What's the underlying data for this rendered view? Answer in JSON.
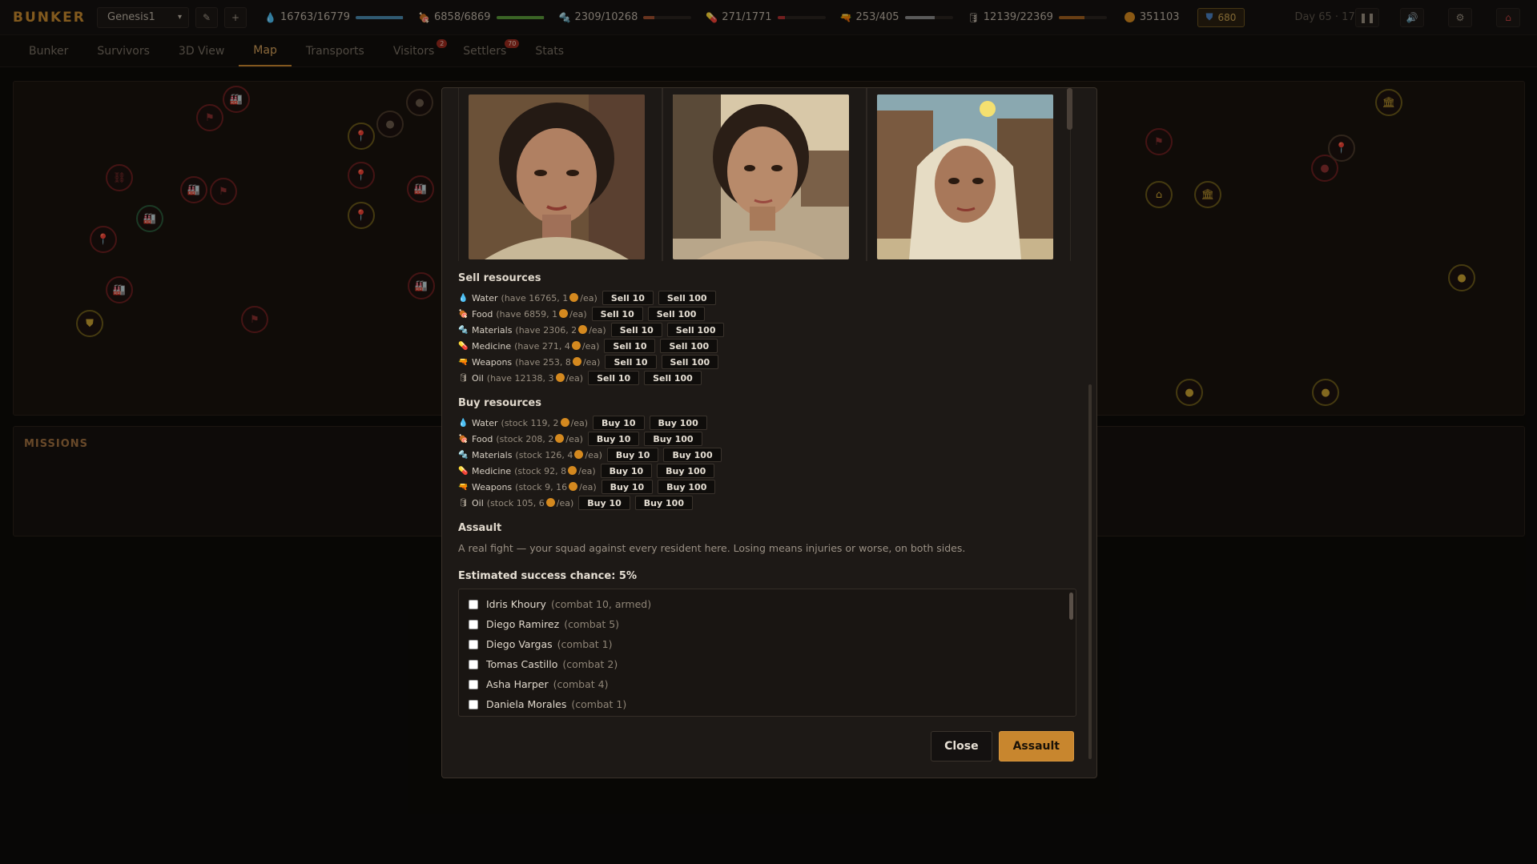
{
  "app": {
    "logo": "BUNKER",
    "save_name": "Genesis1",
    "day_time": "Day 65 · 17:20"
  },
  "resources": [
    {
      "icon": "water-drop-icon",
      "glyph": "💧",
      "text": "16763/16779",
      "fill": 0.99,
      "color": "#4a8ab0"
    },
    {
      "icon": "food-icon",
      "glyph": "🍖",
      "text": "6858/6869",
      "fill": 0.99,
      "color": "#5a9a3a"
    },
    {
      "icon": "materials-icon",
      "glyph": "🔩",
      "text": "2309/10268",
      "fill": 0.22,
      "color": "#a05030"
    },
    {
      "icon": "medicine-icon",
      "glyph": "💊",
      "text": "271/1771",
      "fill": 0.15,
      "color": "#b03030"
    },
    {
      "icon": "weapons-icon",
      "glyph": "🔫",
      "text": "253/405",
      "fill": 0.62,
      "color": "#8a8a8a"
    },
    {
      "icon": "oil-icon",
      "glyph": "🛢",
      "text": "12139/22369",
      "fill": 0.54,
      "color": "#a06020"
    }
  ],
  "coins": "351103",
  "shield": "680",
  "nav": [
    {
      "label": "Bunker",
      "badge": ""
    },
    {
      "label": "Survivors",
      "badge": ""
    },
    {
      "label": "3D View",
      "badge": ""
    },
    {
      "label": "Map",
      "badge": "",
      "active": true
    },
    {
      "label": "Transports",
      "badge": ""
    },
    {
      "label": "Visitors",
      "badge": "2"
    },
    {
      "label": "Settlers",
      "badge": "70"
    },
    {
      "label": "Stats",
      "badge": ""
    }
  ],
  "missions_title": "MISSIONS",
  "modal": {
    "sell_title": "Sell resources",
    "sell": [
      {
        "glyph": "💧",
        "name": "Water",
        "info_pre": "(have 16765, 1",
        "info_post": "/ea)",
        "b1": "Sell 10",
        "b2": "Sell 100"
      },
      {
        "glyph": "🍖",
        "name": "Food",
        "info_pre": "(have 6859, 1",
        "info_post": "/ea)",
        "b1": "Sell 10",
        "b2": "Sell 100"
      },
      {
        "glyph": "🔩",
        "name": "Materials",
        "info_pre": "(have 2306, 2",
        "info_post": "/ea)",
        "b1": "Sell 10",
        "b2": "Sell 100"
      },
      {
        "glyph": "💊",
        "name": "Medicine",
        "info_pre": "(have 271, 4",
        "info_post": "/ea)",
        "b1": "Sell 10",
        "b2": "Sell 100"
      },
      {
        "glyph": "🔫",
        "name": "Weapons",
        "info_pre": "(have 253, 8",
        "info_post": "/ea)",
        "b1": "Sell 10",
        "b2": "Sell 100"
      },
      {
        "glyph": "🛢",
        "name": "Oil",
        "info_pre": "(have 12138, 3",
        "info_post": "/ea)",
        "b1": "Sell 10",
        "b2": "Sell 100"
      }
    ],
    "buy_title": "Buy resources",
    "buy": [
      {
        "glyph": "💧",
        "name": "Water",
        "info_pre": "(stock 119, 2",
        "info_post": "/ea)",
        "b1": "Buy 10",
        "b2": "Buy 100"
      },
      {
        "glyph": "🍖",
        "name": "Food",
        "info_pre": "(stock 208, 2",
        "info_post": "/ea)",
        "b1": "Buy 10",
        "b2": "Buy 100"
      },
      {
        "glyph": "🔩",
        "name": "Materials",
        "info_pre": "(stock 126, 4",
        "info_post": "/ea)",
        "b1": "Buy 10",
        "b2": "Buy 100"
      },
      {
        "glyph": "💊",
        "name": "Medicine",
        "info_pre": "(stock 92, 8",
        "info_post": "/ea)",
        "b1": "Buy 10",
        "b2": "Buy 100"
      },
      {
        "glyph": "🔫",
        "name": "Weapons",
        "info_pre": "(stock 9, 16",
        "info_post": "/ea)",
        "b1": "Buy 10",
        "b2": "Buy 100"
      },
      {
        "glyph": "🛢",
        "name": "Oil",
        "info_pre": "(stock 105, 6",
        "info_post": "/ea)",
        "b1": "Buy 10",
        "b2": "Buy 100"
      }
    ],
    "assault_title": "Assault",
    "assault_desc": "A real fight — your squad against every resident here. Losing means injuries or worse, on both sides.",
    "estimate": "Estimated success chance: 5%",
    "squad": [
      {
        "name": "Idris Khoury",
        "stat": "(combat 10, armed)"
      },
      {
        "name": "Diego Ramirez",
        "stat": "(combat 5)"
      },
      {
        "name": "Diego Vargas",
        "stat": "(combat 1)"
      },
      {
        "name": "Tomas Castillo",
        "stat": "(combat 2)"
      },
      {
        "name": "Asha Harper",
        "stat": "(combat 4)"
      },
      {
        "name": "Daniela Morales",
        "stat": "(combat 1)"
      }
    ],
    "close_label": "Close",
    "assault_label": "Assault"
  }
}
